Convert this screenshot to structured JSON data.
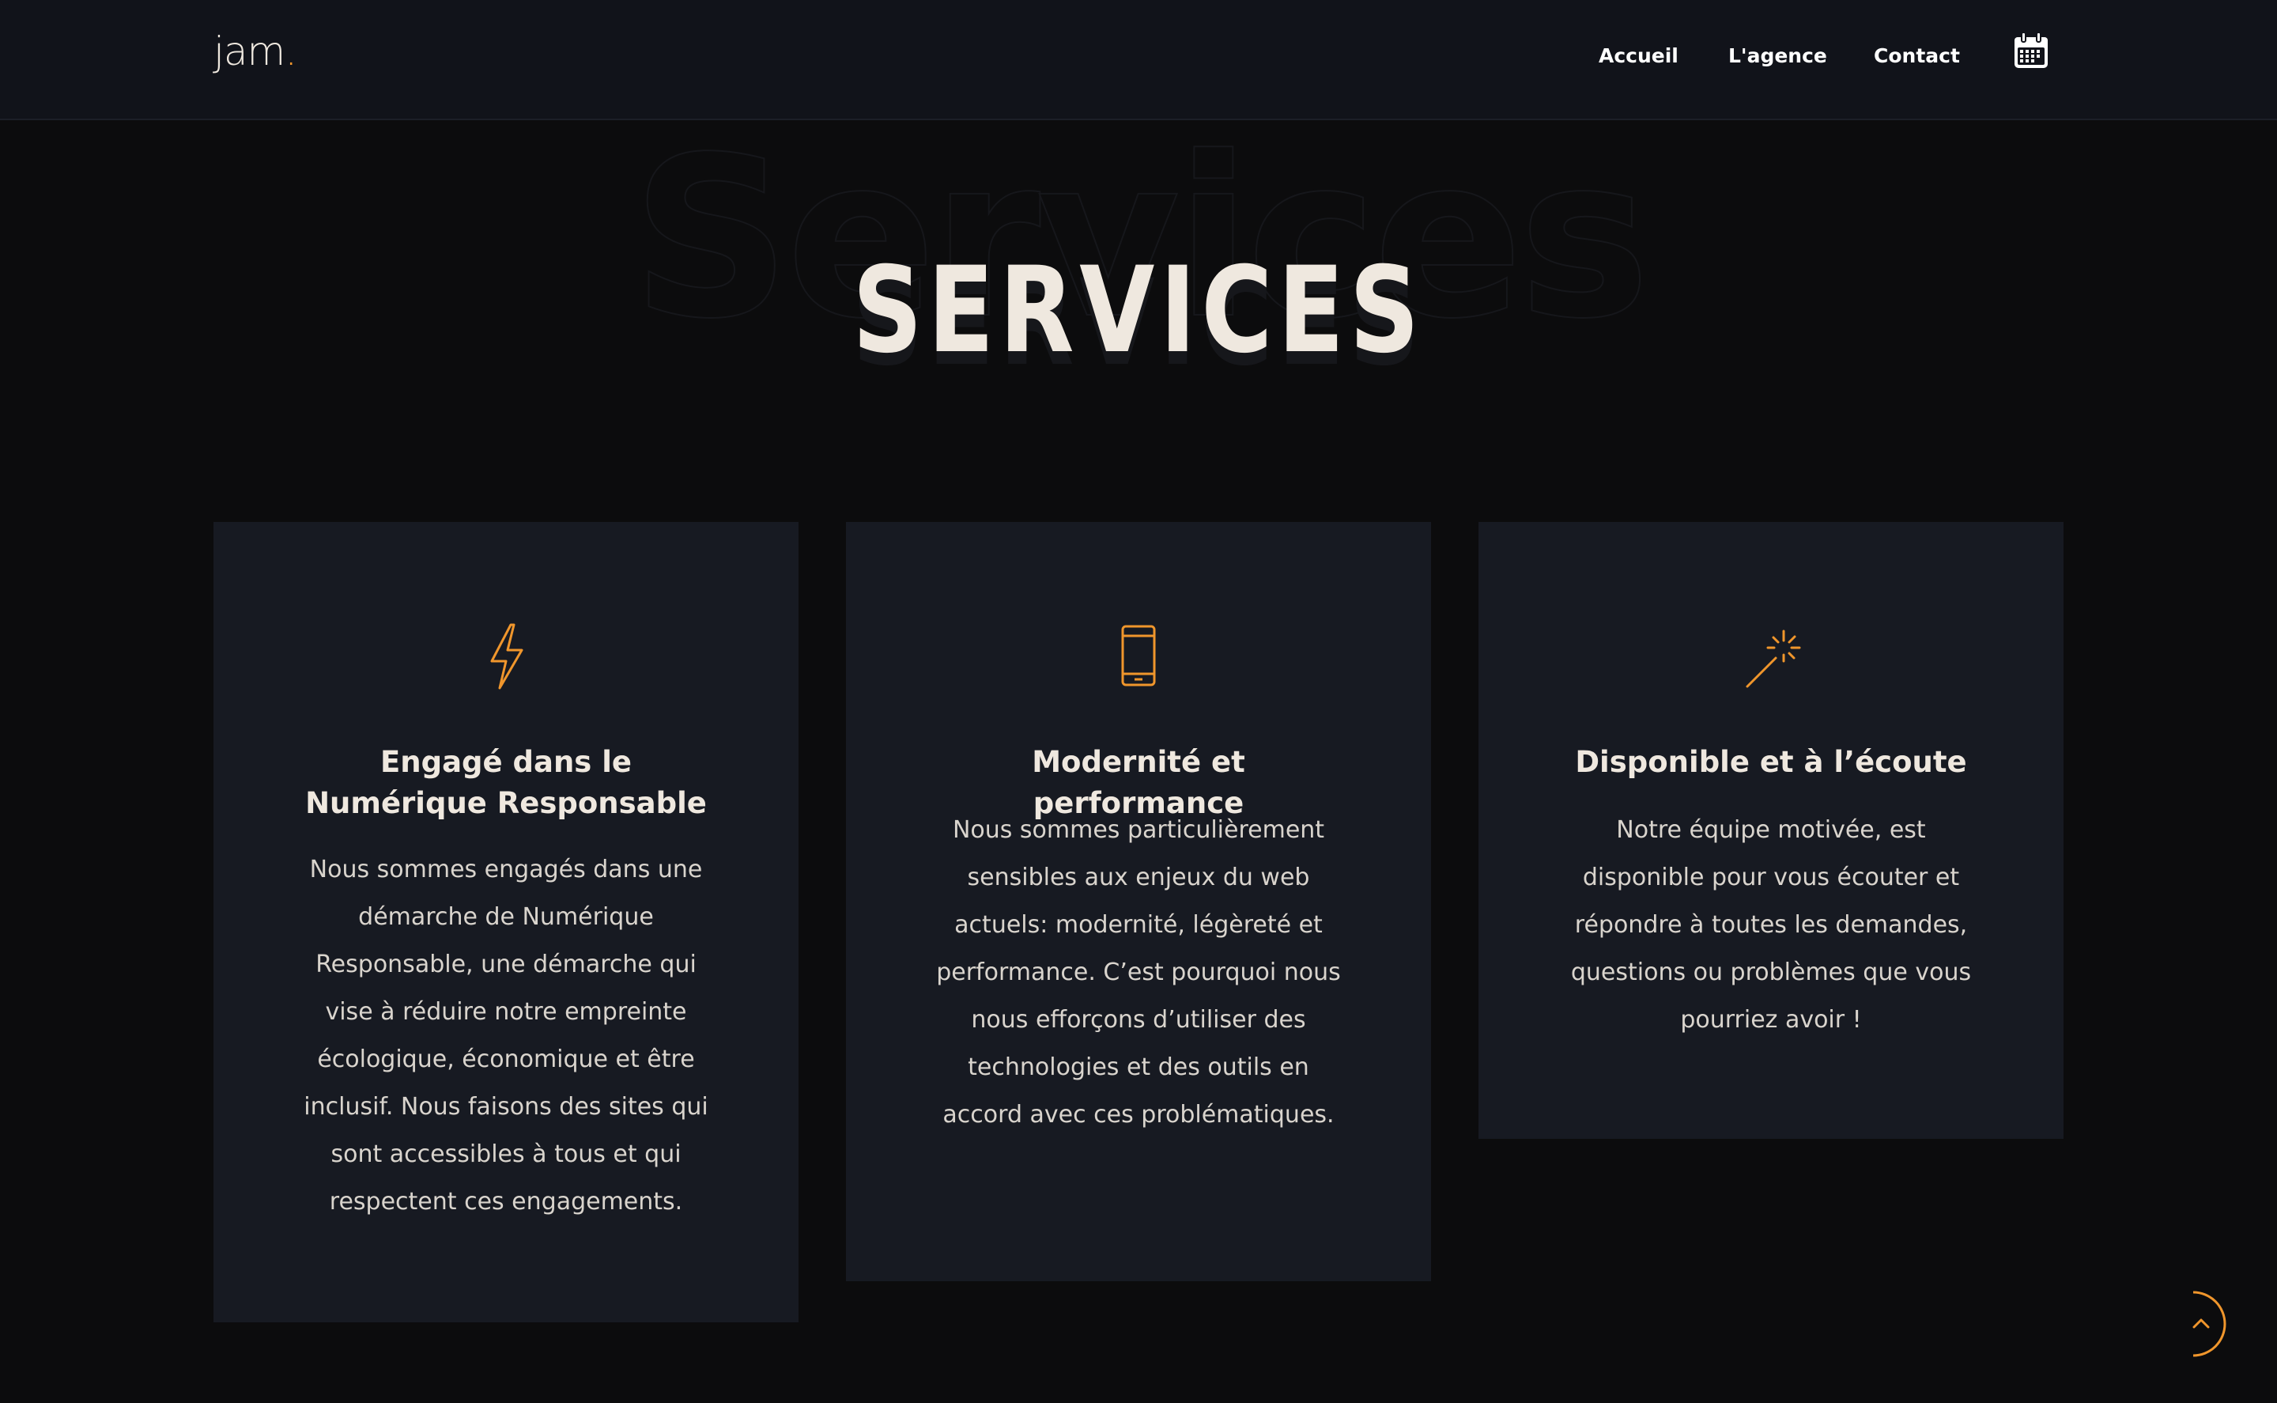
{
  "header": {
    "logo_text": "jam",
    "logo_dot": ".",
    "nav": {
      "accueil": "Accueil",
      "agence": "L'agence",
      "contact": "Contact"
    },
    "calendar_icon": "calendar-icon"
  },
  "hero": {
    "ghost_title": "Services",
    "title": "SERVICES"
  },
  "colors": {
    "accent": "#f0962c",
    "background": "#0c0c0d",
    "header_bg": "#11131a",
    "card_bg": "#171a22",
    "text_light": "#efe8df"
  },
  "cards": [
    {
      "icon": "lightning-icon",
      "title": "Engagé dans le Numérique Responsable",
      "text": "Nous sommes engagés dans une démarche de Numérique Responsable, une démarche qui vise à réduire notre empreinte écologique, économique et être inclusif. Nous faisons des sites qui sont accessibles à tous et qui respectent ces engagements."
    },
    {
      "icon": "mobile-phone-icon",
      "title": "Modernité et performance",
      "text": "Nous sommes particulièrement sensibles aux enjeux du web actuels: modernité, légèreté et performance. C’est pourquoi nous nous efforçons d’utiliser des technologies et des outils en accord avec ces problématiques."
    },
    {
      "icon": "magic-wand-icon",
      "title": "Disponible et à l’écoute",
      "text": "Notre équipe motivée, est disponible pour vous écouter et répondre à toutes les demandes, questions ou problèmes que vous pourriez avoir !"
    }
  ],
  "scroll_top_icon": "chevron-up-icon"
}
